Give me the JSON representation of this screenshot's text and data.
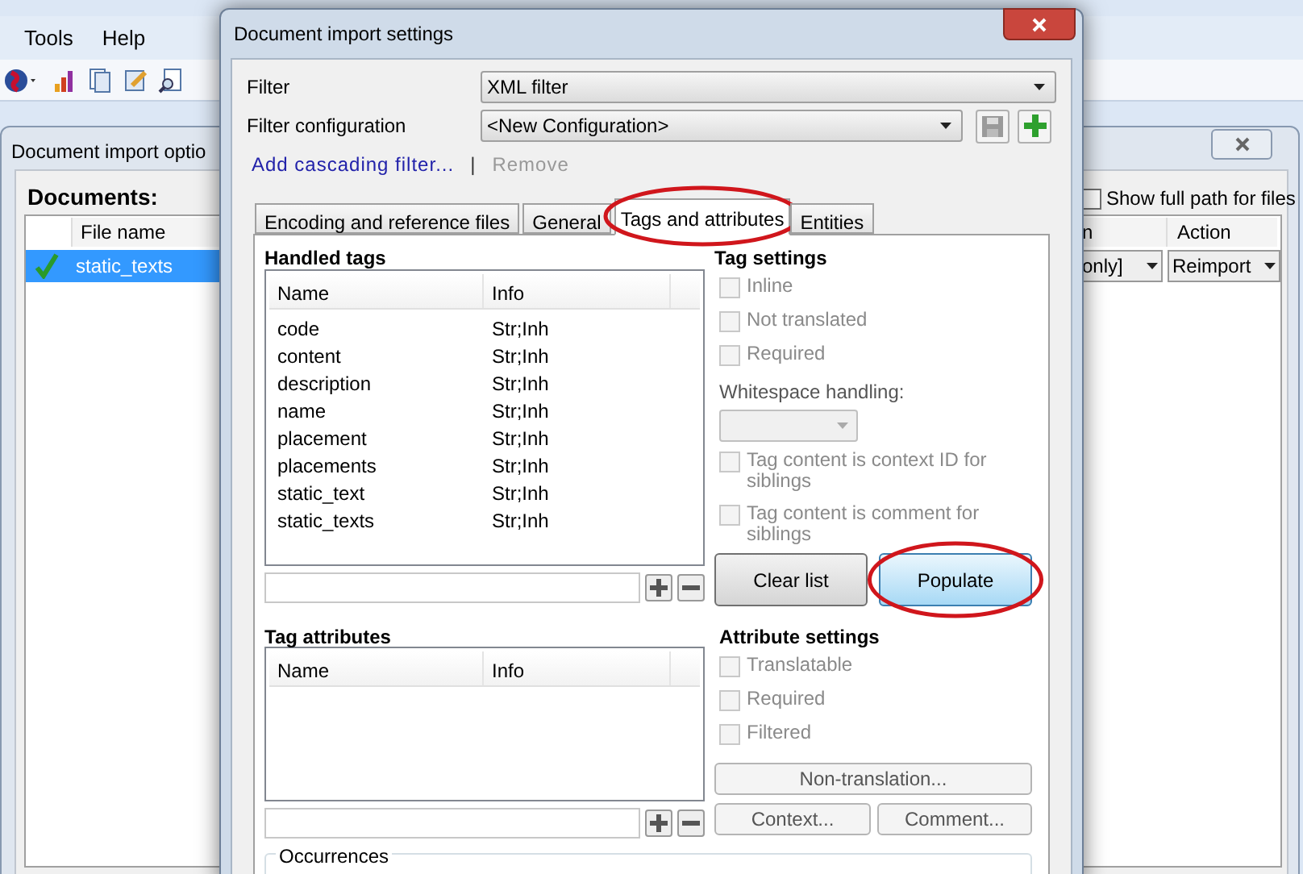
{
  "menu": [
    "Tools",
    "Help"
  ],
  "background_dialog": {
    "title": "Document import optio",
    "documents_label": "Documents:",
    "show_full_path": {
      "label": "Show full path for files",
      "checked": false
    },
    "columns": [
      "File name",
      "n",
      "Action"
    ],
    "rows": [
      {
        "file_name": "static_texts",
        "imported": true,
        "selected": true,
        "column_2": "only]",
        "action": "Reimport"
      }
    ]
  },
  "dialog": {
    "title": "Document import settings",
    "filter": {
      "label": "Filter",
      "value": "XML filter"
    },
    "filter_configuration": {
      "label": "Filter configuration",
      "value": "<New Configuration>"
    },
    "links": [
      {
        "label": "Add cascading filter...",
        "disabled": false
      },
      {
        "label": "Remove",
        "disabled": true
      }
    ],
    "link_separator": "|",
    "tabs": [
      {
        "label": "Encoding and reference files",
        "selected": false,
        "highlighted": false
      },
      {
        "label": "General",
        "selected": false,
        "highlighted": false
      },
      {
        "label": "Tags and attributes",
        "selected": true,
        "highlighted": true
      },
      {
        "label": "Entities",
        "selected": false,
        "highlighted": false
      }
    ],
    "handled_tags": {
      "title": "Handled tags",
      "columns": [
        "Name",
        "Info"
      ],
      "rows": [
        {
          "name": "code",
          "info": "Str;Inh"
        },
        {
          "name": "content",
          "info": "Str;Inh"
        },
        {
          "name": "description",
          "info": "Str;Inh"
        },
        {
          "name": "name",
          "info": "Str;Inh"
        },
        {
          "name": "placement",
          "info": "Str;Inh"
        },
        {
          "name": "placements",
          "info": "Str;Inh"
        },
        {
          "name": "static_text",
          "info": "Str;Inh"
        },
        {
          "name": "static_texts",
          "info": "Str;Inh"
        }
      ]
    },
    "tag_settings": {
      "title": "Tag settings",
      "checks": [
        {
          "label": "Inline",
          "checked": false,
          "disabled": true
        },
        {
          "label": "Not translated",
          "checked": false,
          "disabled": true
        },
        {
          "label": "Required",
          "checked": false,
          "disabled": true
        }
      ],
      "whitespace_label": "Whitespace handling:",
      "checks_2": [
        {
          "label": "Tag content is context ID for siblings",
          "checked": false,
          "disabled": true
        },
        {
          "label": "Tag content is comment for siblings",
          "checked": false,
          "disabled": true
        }
      ],
      "buttons": [
        {
          "label": "Clear list",
          "highlighted": false
        },
        {
          "label": "Populate",
          "highlighted": true
        }
      ]
    },
    "tag_attributes": {
      "title": "Tag attributes",
      "columns": [
        "Name",
        "Info"
      ]
    },
    "attribute_settings": {
      "title": "Attribute settings",
      "checks": [
        {
          "label": "Translatable",
          "checked": false,
          "disabled": true
        },
        {
          "label": "Required",
          "checked": false,
          "disabled": true
        },
        {
          "label": "Filtered",
          "checked": false,
          "disabled": true
        }
      ],
      "buttons": [
        "Non-translation...",
        "Context...",
        "Comment..."
      ]
    },
    "occurrences_label": "Occurrences"
  }
}
